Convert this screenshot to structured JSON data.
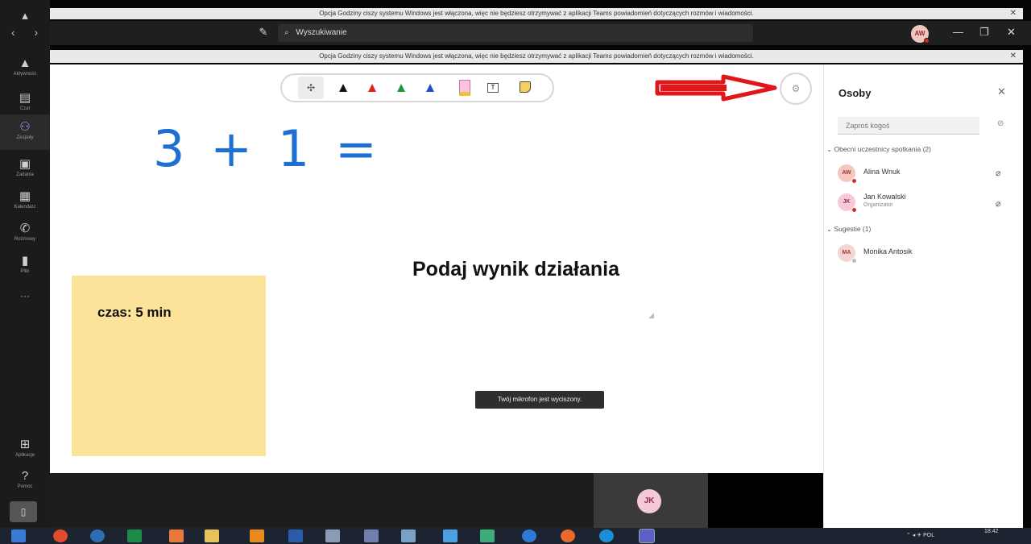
{
  "notice": {
    "text": "Opcja Godziny ciszy systemu Windows jest włączona, więc nie będziesz otrzymywać z aplikacji Teams powiadomień dotyczących rozmów i wiadomości.",
    "close": "✕"
  },
  "titlebar": {
    "nav": "‹ ›",
    "compose": "✎",
    "search_icon": "⌕",
    "search_placeholder": "Wyszukiwanie",
    "user_initials": "AW",
    "minimize": "—",
    "maximize": "❐",
    "close": "✕"
  },
  "rail": {
    "items": [
      {
        "icon": "bell-icon",
        "glyph": "🔔︎",
        "label": "Aktywność"
      },
      {
        "icon": "chat-icon",
        "glyph": "▤",
        "label": "Czat"
      },
      {
        "icon": "teams-icon",
        "glyph": "⚇",
        "label": "Zespoły"
      },
      {
        "icon": "assignments-icon",
        "glyph": "▣",
        "label": "Zadania"
      },
      {
        "icon": "calendar-icon",
        "glyph": "▦",
        "label": "Kalendarz"
      },
      {
        "icon": "calls-icon",
        "glyph": "✆",
        "label": "Rozmowy"
      },
      {
        "icon": "files-icon",
        "glyph": "▮",
        "label": "Pliki"
      }
    ],
    "more": "···",
    "apps": {
      "glyph": "⊞",
      "label": "Aplikacje"
    },
    "help": {
      "glyph": "?",
      "label": "Pomoc"
    },
    "device": "▯"
  },
  "whiteboard": {
    "handwriting": "3 + 1 =",
    "title": "Podaj wynik działania",
    "sticky_note": "czas:  5 min",
    "toast": "Twój mikrofon jest wyciszony.",
    "tools": {
      "move": "✣",
      "pen": "▲",
      "text": "T"
    },
    "settings": "⚙"
  },
  "video": {
    "participant_initials": "JK"
  },
  "people": {
    "title": "Osoby",
    "close": "✕",
    "invite_placeholder": "Zaproś kogoś",
    "current_header": "Obecni uczestnicy spotkania (2)",
    "participants": [
      {
        "initials": "AW",
        "name": "Alina Wnuk",
        "role": ""
      },
      {
        "initials": "JK",
        "name": "Jan Kowalski",
        "role": "Organizator"
      }
    ],
    "suggestions_header": "Sugestie (1)",
    "suggestions": [
      {
        "initials": "MA",
        "name": "Monika Antosik"
      }
    ],
    "mic_muted": "🎙︎"
  },
  "taskbar": {
    "lang": "POL",
    "time": "18:42"
  },
  "colors": {
    "annotation_arrow": "#e0161b",
    "handwriting": "#1e6fd4",
    "sticky": "#fde29a"
  }
}
